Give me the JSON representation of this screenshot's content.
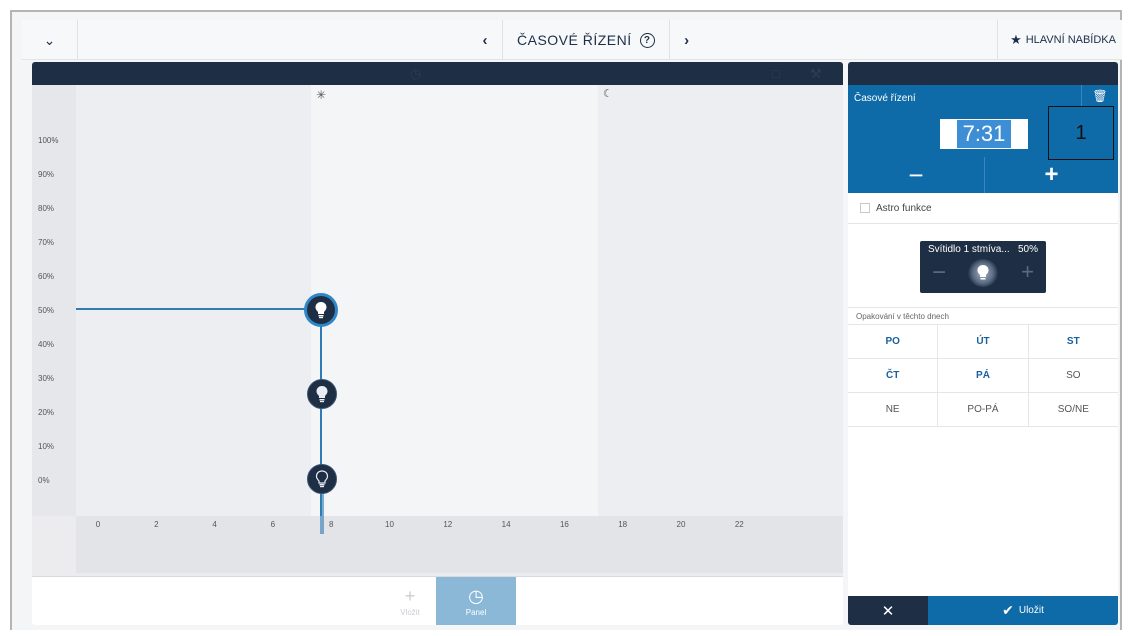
{
  "topbar": {
    "dropdown_icon": "chevron-down-icon",
    "prev_icon": "chevron-left-icon",
    "next_icon": "chevron-right-icon",
    "title": "ČASOVÉ ŘÍZENÍ",
    "help_icon": "help-circle-icon",
    "main_menu_label": "HLAVNÍ NABÍDKA",
    "main_menu_icon": "star-icon"
  },
  "chart": {
    "y_ticks": [
      "100%",
      "90%",
      "80%",
      "70%",
      "60%",
      "50%",
      "40%",
      "30%",
      "20%",
      "10%",
      "0%"
    ],
    "x_ticks": [
      "0",
      "2",
      "4",
      "6",
      "8",
      "10",
      "12",
      "14",
      "16",
      "18",
      "20",
      "22"
    ],
    "day_icon": "sun-icon",
    "night_icon": "moon-icon"
  },
  "chart_data": {
    "type": "line",
    "xlabel": "",
    "ylabel": "",
    "xlim": [
      0,
      24
    ],
    "ylim": [
      0,
      100
    ],
    "series": [
      {
        "x": [
          0,
          7.52
        ],
        "y": [
          50,
          50
        ]
      }
    ],
    "points": [
      {
        "x": 7.52,
        "y": 50,
        "selected": true
      },
      {
        "x": 7.52,
        "y": 25,
        "selected": false
      },
      {
        "x": 7.52,
        "y": 0,
        "selected": false
      }
    ]
  },
  "left_footer": {
    "add_label": "Vložit",
    "add_icon": "plus-icon",
    "panel_label": "Panel",
    "panel_icon": "timer-icon"
  },
  "right_panel": {
    "section_title": "Časové řízení",
    "trash_icon": "trash-icon",
    "time_value": "7:31",
    "annotation_marker": "1",
    "minus_label": "−",
    "plus_label": "+",
    "astro_label": "Astro funkce",
    "device": {
      "name": "Svítidlo 1 stmíva...",
      "value": "50%",
      "minus": "−",
      "plus": "+",
      "icon": "lightbulb-icon"
    },
    "repeat_label": "Opakování v těchto dnech",
    "days": [
      [
        {
          "label": "PO",
          "active": true
        },
        {
          "label": "ÚT",
          "active": true
        },
        {
          "label": "ST",
          "active": true
        }
      ],
      [
        {
          "label": "ČT",
          "active": true
        },
        {
          "label": "PÁ",
          "active": true
        },
        {
          "label": "SO",
          "active": false
        }
      ],
      [
        {
          "label": "NE",
          "active": false
        },
        {
          "label": "PO-PÁ",
          "active": false
        },
        {
          "label": "SO/NE",
          "active": false
        }
      ]
    ],
    "cancel_icon": "close-icon",
    "save_label": "Uložit",
    "save_icon": "checkmark-icon"
  }
}
